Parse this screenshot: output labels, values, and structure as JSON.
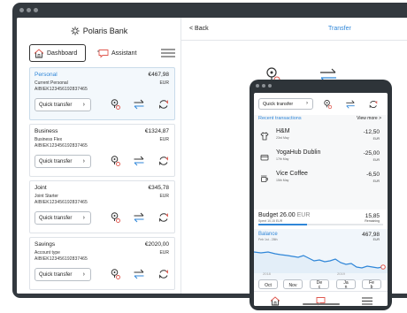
{
  "brand": {
    "name": "Polaris Bank"
  },
  "nav": {
    "dashboard": "Dashboard",
    "assistant": "Assistant"
  },
  "accounts": [
    {
      "name": "Personal",
      "balance": "€467,98",
      "type": "Current Personal",
      "currency": "EUR",
      "iban": "AIBIEK123456192837465",
      "quick": "Quick transfer",
      "selected": true
    },
    {
      "name": "Business",
      "balance": "€1324,87",
      "type": "Business Flex",
      "currency": "EUR",
      "iban": "AIBIEK123456192837465",
      "quick": "Quick transfer",
      "selected": false
    },
    {
      "name": "Joint",
      "balance": "€345,78",
      "type": "Joint Starter",
      "currency": "EUR",
      "iban": "AIBIEK123456192837465",
      "quick": "Quick transfer",
      "selected": false
    },
    {
      "name": "Savings",
      "balance": "€2020,00",
      "type": "Account type",
      "currency": "EUR",
      "iban": "AIBIEK123456192837465",
      "quick": "Quick transfer",
      "selected": false
    }
  ],
  "main": {
    "back": "< Back",
    "title": "Transfer",
    "edge_labels": {
      "a": "o a",
      "b": "ficl",
      "c": "cer",
      "d": "sfer",
      "e": "Ad",
      "f": "Ad"
    }
  },
  "phone": {
    "quick": "Quick transfer",
    "recent_title": "Recent transactions",
    "view_more": "View more >",
    "transactions": [
      {
        "name": "H&M",
        "date": "23rd May",
        "amount": "-12,50",
        "currency": "EUR",
        "icon": "shirt-icon"
      },
      {
        "name": "YogaHub Dublin",
        "date": "17th May",
        "amount": "-25,00",
        "currency": "EUR",
        "icon": "card-icon"
      },
      {
        "name": "Vice Coffee",
        "date": "15th May",
        "amount": "-6,50",
        "currency": "EUR",
        "icon": "coffee-icon"
      }
    ],
    "budget": {
      "title": "Budget 26.00",
      "currency": "EUR",
      "sub": "Spent 10,15 EUR",
      "amount": "15,85",
      "remaining": "Remaining",
      "spent_fraction": 0.39
    },
    "balance": {
      "title": "Balance",
      "sub": "Feb 1st - 28th",
      "amount": "467,98",
      "currency": "EUR"
    },
    "years": [
      "2018",
      "2019"
    ],
    "months": [
      "Oct",
      "Nov",
      "De c",
      "Ja n",
      "Fe b"
    ]
  },
  "colors": {
    "accent": "#2f86d8",
    "alert": "#e0584f",
    "frame": "#33393f"
  }
}
